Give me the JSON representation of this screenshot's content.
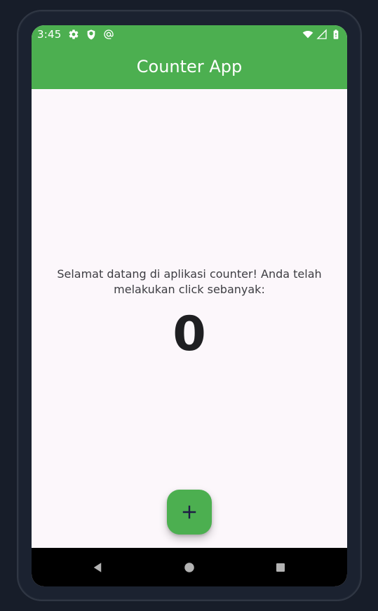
{
  "status_bar": {
    "time": "3:45",
    "left_icons": [
      "gear-icon",
      "shield-icon",
      "at-icon"
    ],
    "right_icons": [
      "wifi-icon",
      "signal-icon",
      "battery-icon"
    ]
  },
  "app_bar": {
    "title": "Counter App",
    "color": "#4caf50"
  },
  "main": {
    "message": "Selamat datang di aplikasi counter! Anda telah melakukan click sebanyak:",
    "counter_value": "0"
  },
  "fab": {
    "icon": "plus-icon",
    "color": "#4caf50"
  },
  "navigation_bar": {
    "buttons": [
      "back-icon",
      "home-icon",
      "recent-apps-icon"
    ]
  }
}
